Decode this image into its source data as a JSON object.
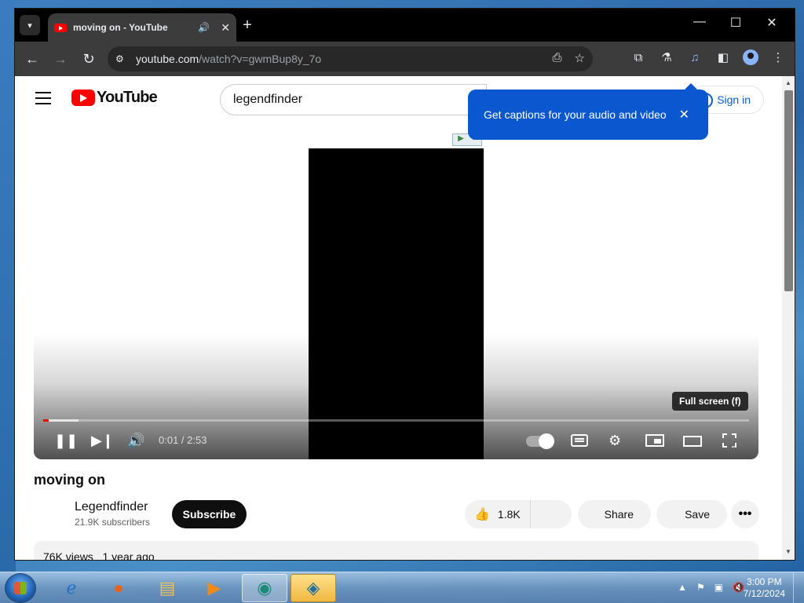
{
  "browser": {
    "tab_title": "moving on - YouTube",
    "tab_audio_icon": "speaker-icon",
    "tab_close": "✕",
    "new_tab": "+",
    "window_controls": {
      "minimize": "—",
      "maximize": "☐",
      "close": "✕"
    },
    "url_host": "youtube.com",
    "url_path": "/watch?v=gwmBup8y_7o"
  },
  "youtube": {
    "logo_text": "YouTube",
    "search_value": "legendfinder",
    "signin_label": "Sign in",
    "popup_text": "Get captions for your audio and video",
    "popup_close": "✕"
  },
  "player": {
    "tooltip": "Full screen (f)",
    "time": "0:01 / 2:53",
    "progress_played_fraction": 0.008,
    "progress_buffered_fraction": 0.05
  },
  "video": {
    "title": "moving on",
    "channel": "Legendfinder",
    "subscribers": "21.9K subscribers",
    "subscribe_label": "Subscribe",
    "likes": "1.8K",
    "share_label": "Share",
    "save_label": "Save",
    "more_label": "•••",
    "views": "76K views",
    "age": "1 year ago"
  },
  "taskbar": {
    "time": "3:00 PM",
    "date": "7/12/2024"
  },
  "colors": {
    "youtube_red": "#ff0000",
    "popup_blue": "#0b57d0",
    "signin_blue": "#065fd4"
  }
}
